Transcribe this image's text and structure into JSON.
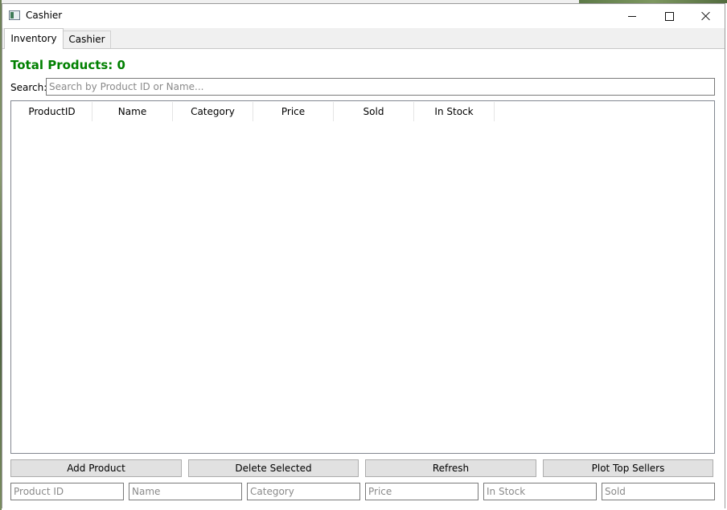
{
  "window": {
    "title": "Cashier"
  },
  "tabs": [
    {
      "label": "Inventory",
      "active": true
    },
    {
      "label": "Cashier",
      "active": false
    }
  ],
  "inventory": {
    "total_label": "Total Products: 0",
    "search_label": "Search:",
    "search_placeholder": "Search by Product ID or Name...",
    "search_value": "",
    "columns": [
      "ProductID",
      "Name",
      "Category",
      "Price",
      "Sold",
      "In Stock"
    ],
    "rows": [],
    "buttons": {
      "add": "Add Product",
      "delete": "Delete Selected",
      "refresh": "Refresh",
      "plot": "Plot Top Sellers"
    },
    "fields": {
      "product_id": "Product ID",
      "name": "Name",
      "category": "Category",
      "price": "Price",
      "in_stock": "In Stock",
      "sold": "Sold"
    }
  },
  "colors": {
    "total_text": "#008000",
    "button_bg": "#e1e1e1",
    "tab_bg": "#f0f0f0"
  },
  "icons": [
    "app-icon",
    "minimize-icon",
    "maximize-icon",
    "close-icon"
  ]
}
